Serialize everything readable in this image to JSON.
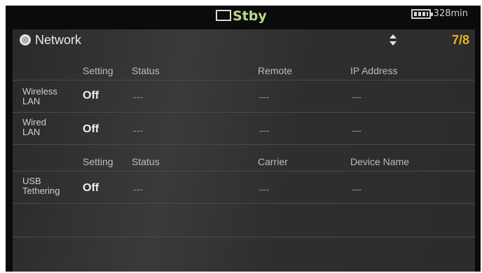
{
  "status_bar": {
    "mode": "Stby",
    "battery": "328min"
  },
  "panel": {
    "title": "Network",
    "page": "7/8"
  },
  "table1": {
    "headers": {
      "setting": "Setting",
      "status": "Status",
      "remote": "Remote",
      "ip": "IP Address"
    },
    "rows": [
      {
        "label_line1": "Wireless",
        "label_line2": "LAN",
        "setting": "Off",
        "status": "---",
        "remote": "---",
        "ip": "---"
      },
      {
        "label_line1": "Wired",
        "label_line2": "LAN",
        "setting": "Off",
        "status": "---",
        "remote": "---",
        "ip": "---"
      }
    ]
  },
  "table2": {
    "headers": {
      "setting": "Setting",
      "status": "Status",
      "carrier": "Carrier",
      "device": "Device Name"
    },
    "rows": [
      {
        "label_line1": "USB",
        "label_line2": "Tethering",
        "setting": "Off",
        "status": "---",
        "carrier": "---",
        "device": "---"
      }
    ]
  }
}
